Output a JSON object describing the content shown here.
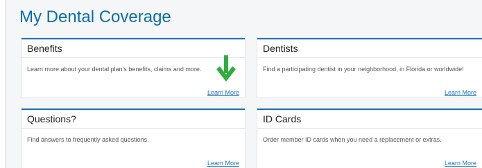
{
  "page": {
    "title": "My Dental Coverage"
  },
  "cards": [
    {
      "title": "Benefits",
      "description": "Learn more about your dental plan's benefits, claims and more.",
      "link": "Learn More"
    },
    {
      "title": "Dentists",
      "description": "Find a participating dentist in your neighborhood, in Florida or worldwide!",
      "link": "Learn More"
    },
    {
      "title": "Questions?",
      "description": "Find answers to frequently asked questions.",
      "link": "Learn More"
    },
    {
      "title": "ID Cards",
      "description": "Order member ID cards when you need a replacement or extras.",
      "link": "Learn More"
    }
  ],
  "colors": {
    "accent": "#1a73b8",
    "arrow": "#2fae3c",
    "title": "#0b6ea8"
  },
  "icons": {
    "annotation": "arrow-down-icon"
  }
}
